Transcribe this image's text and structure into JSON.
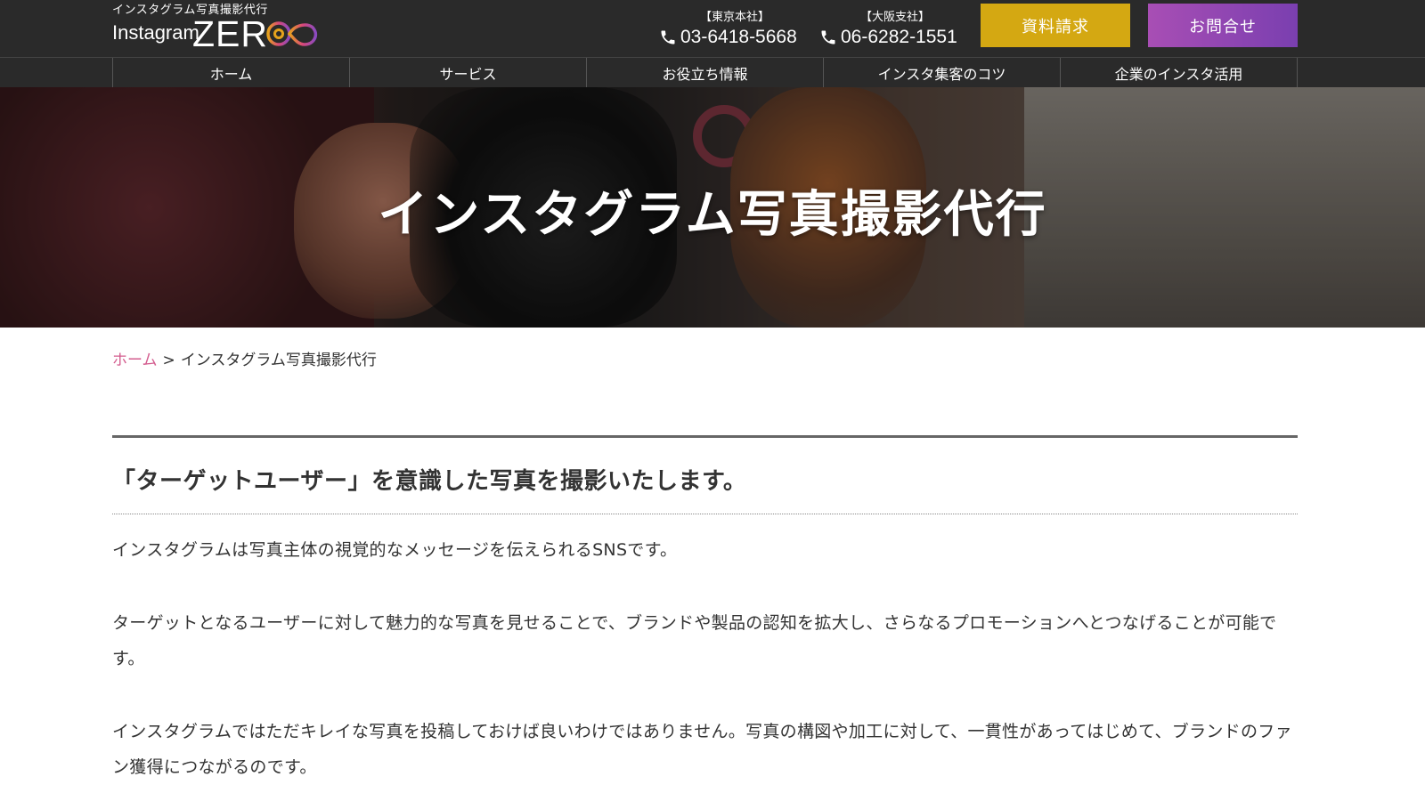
{
  "header": {
    "logo_tagline": "インスタグラム写真撮影代行",
    "logo_instagram": "Instagram",
    "logo_zero": "ZER",
    "phones": [
      {
        "office": "【東京本社】",
        "number": "03-6418-5668"
      },
      {
        "office": "【大阪支社】",
        "number": "06-6282-1551"
      }
    ],
    "doc_request_label": "資料請求",
    "contact_label": "お問合せ"
  },
  "nav": {
    "items": [
      {
        "label": "ホーム"
      },
      {
        "label": "サービス"
      },
      {
        "label": "お役立ち情報"
      },
      {
        "label": "インスタ集客のコツ"
      },
      {
        "label": "企業のインスタ活用"
      }
    ]
  },
  "hero": {
    "title": "インスタグラム写真撮影代行"
  },
  "breadcrumb": {
    "home": "ホーム",
    "separator": ">",
    "current": "インスタグラム写真撮影代行"
  },
  "main": {
    "heading": "「ターゲットユーザー」を意識した写真を撮影いたします。",
    "paragraphs": [
      "インスタグラムは写真主体の視覚的なメッセージを伝えられるSNSです。",
      "ターゲットとなるユーザーに対して魅力的な写真を見せることで、ブランドや製品の認知を拡大し、さらなるプロモーションへとつなげることが可能です。",
      "インスタグラムではただキレイな写真を投稿しておけば良いわけではありません。写真の構図や加工に対して、一貫性があってはじめて、ブランドのファン獲得につながるのです。"
    ]
  },
  "colors": {
    "header_bg": "#2a2a2a",
    "doc_button": "#d4a812",
    "contact_button": "#8e48b2",
    "breadcrumb_link": "#d35c8e"
  },
  "icons": {
    "phone": "phone-icon",
    "logo_mark": "infinity-logo-icon"
  }
}
